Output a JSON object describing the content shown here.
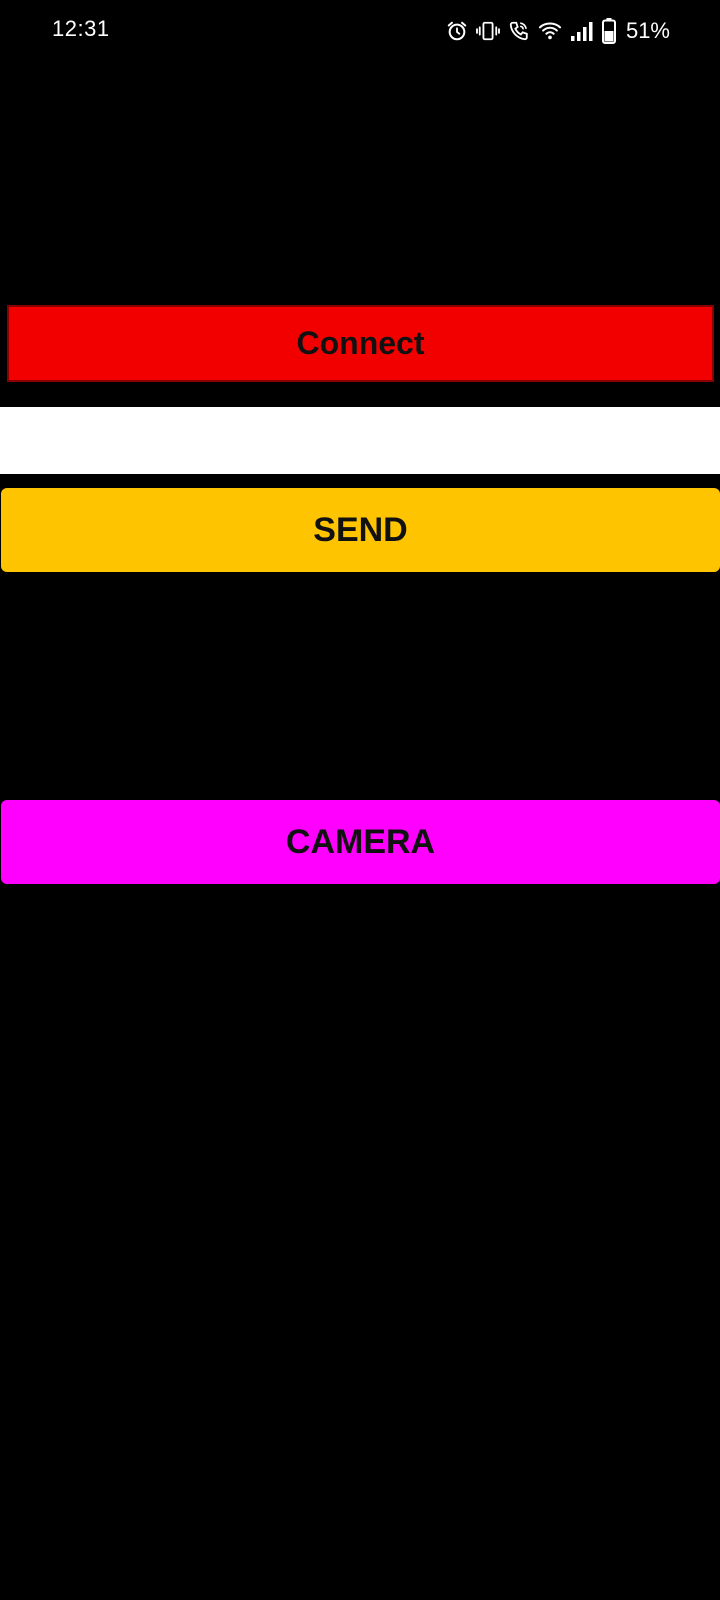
{
  "status_bar": {
    "time": "12:31",
    "battery_percent": "51%",
    "icons": [
      "alarm-icon",
      "vibrate-icon",
      "wifi-call-icon",
      "wifi-icon",
      "signal-icon",
      "battery-icon"
    ]
  },
  "buttons": {
    "connect": {
      "label": "Connect",
      "color": "#f20000"
    },
    "send": {
      "label": "SEND",
      "color": "#ffc400"
    },
    "camera": {
      "label": "CAMERA",
      "color": "#ff00ff"
    }
  },
  "message_input": {
    "value": "",
    "placeholder": ""
  }
}
